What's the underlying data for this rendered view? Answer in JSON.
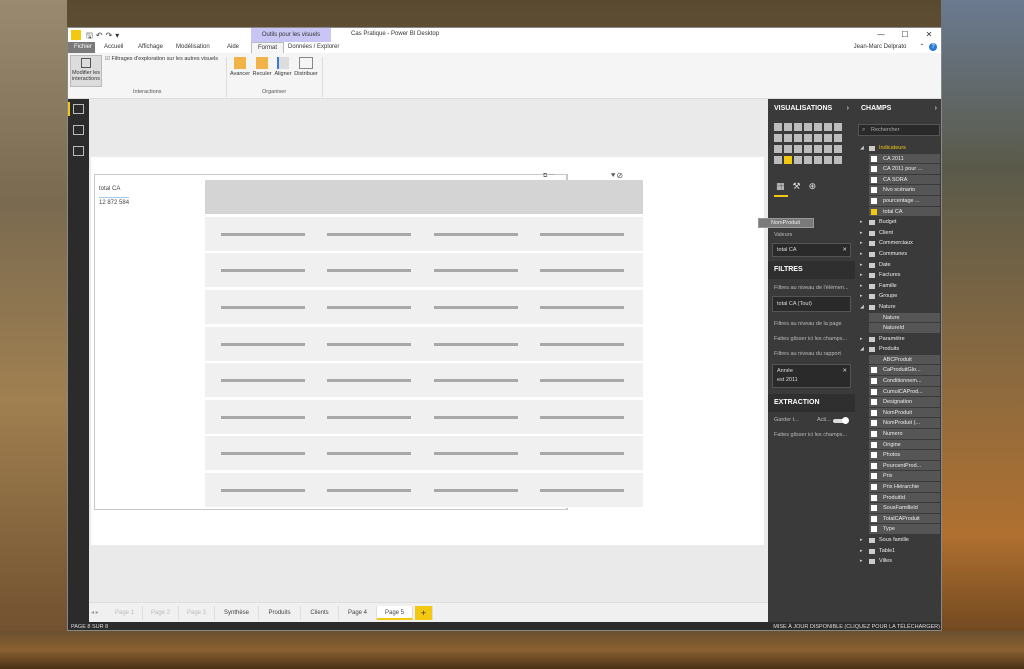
{
  "window": {
    "title": "Cas Pratique - Power BI Desktop",
    "contextual_tab": "Outils pour les visuels",
    "user": "Jean-Marc Delprato",
    "controls": [
      "—",
      "☐",
      "✕"
    ]
  },
  "ribbon_tabs": [
    "Fichier",
    "Accueil",
    "Affichage",
    "Modélisation",
    "Aide",
    "Format",
    "Données / Explorer"
  ],
  "ribbon": {
    "modify_interactions": "Modifier les interactions",
    "drill_filter": "Filtrages d'exploration sur les autres visuels",
    "group_interactions": "Interactions",
    "advance": "Avancer",
    "back": "Reculer",
    "align": "Aligner",
    "distribute": "Distribuer",
    "group_organize": "Organiser"
  },
  "card": {
    "label": "total CA",
    "value": "12 872 584"
  },
  "page_tabs": [
    {
      "label": "Page 1",
      "state": "dim"
    },
    {
      "label": "Page 2",
      "state": "dim"
    },
    {
      "label": "Page 3",
      "state": "dim"
    },
    {
      "label": "Synthèse",
      "state": "normal"
    },
    {
      "label": "Produits",
      "state": "normal"
    },
    {
      "label": "Clients",
      "state": "normal"
    },
    {
      "label": "Page 4",
      "state": "normal"
    },
    {
      "label": "Page 5",
      "state": "active"
    }
  ],
  "add_page": "+",
  "status": {
    "left": "PAGE 8 SUR 8",
    "right": "MISE À JOUR DISPONIBLE (CLIQUEZ POUR LA TÉLÉCHARGER)"
  },
  "visualizations": {
    "header": "VISUALISATIONS",
    "values_label": "Valeurs",
    "values_well": "total CA",
    "drag_chip": "NomProduit",
    "filters_header": "FILTRES",
    "visual_level": "Filtres au niveau de l'élémen...",
    "visual_filter": "total CA (Tout)",
    "page_level": "Filtres au niveau de la page",
    "page_drop": "Faites glisser ici les champs...",
    "report_level": "Filtres au niveau du rapport",
    "report_filter_field": "Année",
    "report_filter_value": "est 2011",
    "extraction_header": "EXTRACTION",
    "keep_label": "Garder t...",
    "keep_state": "Acti...",
    "extraction_drop": "Faites glisser ici les champs..."
  },
  "fields": {
    "header": "CHAMPS",
    "search_placeholder": "Rechercher",
    "items": [
      {
        "kind": "table",
        "label": "Indicateurs",
        "expanded": true,
        "highlight": true
      },
      {
        "kind": "child",
        "label": "CA 2011",
        "checked": false
      },
      {
        "kind": "child",
        "label": "CA 2011 pour ...",
        "checked": false
      },
      {
        "kind": "child",
        "label": "CA SORA",
        "checked": false
      },
      {
        "kind": "child",
        "label": "Nvo scénario",
        "checked": false
      },
      {
        "kind": "child",
        "label": "pourcentage ...",
        "checked": false
      },
      {
        "kind": "child",
        "label": "total CA",
        "checked": true
      },
      {
        "kind": "table",
        "label": "Budget",
        "expanded": false
      },
      {
        "kind": "table",
        "label": "Client",
        "expanded": false
      },
      {
        "kind": "table",
        "label": "Commerciaux",
        "expanded": false
      },
      {
        "kind": "table",
        "label": "Communes",
        "expanded": false
      },
      {
        "kind": "table",
        "label": "Date",
        "expanded": false
      },
      {
        "kind": "table",
        "label": "Factures",
        "expanded": false
      },
      {
        "kind": "table",
        "label": "Famille",
        "expanded": false
      },
      {
        "kind": "table",
        "label": "Groupe",
        "expanded": false
      },
      {
        "kind": "table",
        "label": "Nature",
        "expanded": true
      },
      {
        "kind": "child",
        "label": "Nature",
        "checked": null
      },
      {
        "kind": "child",
        "label": "NatureId",
        "checked": null
      },
      {
        "kind": "table",
        "label": "Paramètre",
        "expanded": false
      },
      {
        "kind": "table",
        "label": "Produits",
        "expanded": true
      },
      {
        "kind": "child",
        "label": "ABCProduit",
        "checked": null
      },
      {
        "kind": "child",
        "label": "CaProduitGlo...",
        "checked": false
      },
      {
        "kind": "child",
        "label": "Conditionnem...",
        "checked": false
      },
      {
        "kind": "child",
        "label": "CumulCAProd...",
        "checked": false
      },
      {
        "kind": "child",
        "label": "Designation",
        "checked": false
      },
      {
        "kind": "child",
        "label": "NomProduit",
        "checked": false
      },
      {
        "kind": "child",
        "label": "NomProduit (...",
        "checked": false
      },
      {
        "kind": "child",
        "label": "Numero",
        "checked": false
      },
      {
        "kind": "child",
        "label": "Origine",
        "checked": false
      },
      {
        "kind": "child",
        "label": "Photos",
        "checked": false
      },
      {
        "kind": "child",
        "label": "PourcentProd...",
        "checked": false
      },
      {
        "kind": "child",
        "label": "Prix",
        "checked": false
      },
      {
        "kind": "child",
        "label": "Prix Hiérarchie",
        "checked": false
      },
      {
        "kind": "child",
        "label": "ProduitId",
        "checked": false
      },
      {
        "kind": "child",
        "label": "SousFamilleId",
        "checked": false
      },
      {
        "kind": "child",
        "label": "TotalCAProduit",
        "checked": false
      },
      {
        "kind": "child",
        "label": "Type",
        "checked": false
      },
      {
        "kind": "table",
        "label": "Sous famille",
        "expanded": false
      },
      {
        "kind": "table",
        "label": "Table1",
        "expanded": false
      },
      {
        "kind": "table",
        "label": "Villes",
        "expanded": false
      }
    ]
  },
  "colors": {
    "accent": "#f2c811",
    "contextual": "#c9c6f5",
    "pane": "#3a3a3a"
  }
}
